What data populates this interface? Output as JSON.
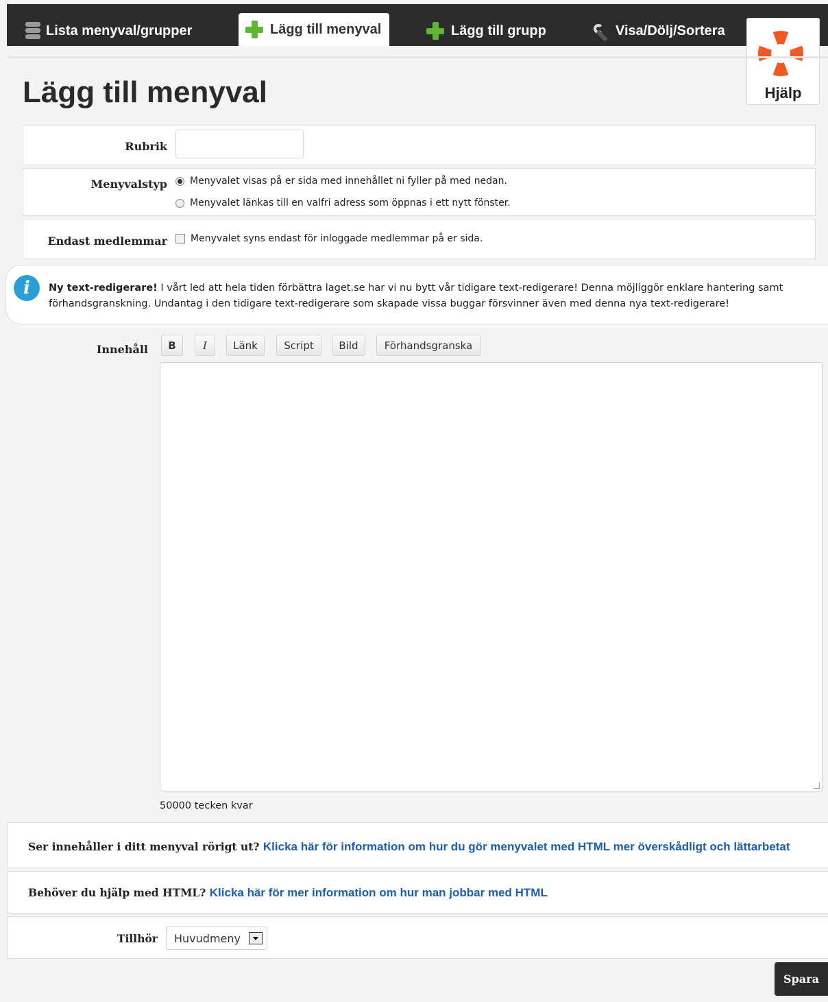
{
  "tabs": [
    {
      "label": "Lista menyval/grupper",
      "icon": "list-stack-icon"
    },
    {
      "label": "Lägg till menyval",
      "icon": "plus-icon"
    },
    {
      "label": "Lägg till grupp",
      "icon": "plus-icon"
    },
    {
      "label": "Visa/Dölj/Sortera",
      "icon": "wrench-icon"
    }
  ],
  "help": {
    "label": "Hjälp",
    "icon": "lifebuoy-icon"
  },
  "page": {
    "title": "Lägg till menyval"
  },
  "form": {
    "rubrik_label": "Rubrik",
    "rubrik_value": "",
    "type_label": "Menyvalstyp",
    "type_options": [
      {
        "label": "Menyvalet visas på er sida med innehållet ni fyller på med nedan.",
        "selected": true
      },
      {
        "label": "Menyvalet länkas till en valfri adress som öppnas i ett nytt fönster.",
        "selected": false
      }
    ],
    "members_label": "Endast medlemmar",
    "members_option": "Menyvalet syns endast för inloggade medlemmar på er sida.",
    "members_checked": false
  },
  "notice": {
    "title": "Ny text-redigerare!",
    "body": " I vårt led att hela tiden förbättra laget.se har vi nu bytt vår tidigare text-redigerare! Denna möjliggör enklare hantering samt förhandsgranskning. Undantag i den tidigare text-redigerare som skapade vissa buggar försvinner även med denna nya text-redigerare!"
  },
  "editor": {
    "label": "Innehåll",
    "toolbar": [
      "B",
      "I",
      "Länk",
      "Script",
      "Bild",
      "Förhandsgranska"
    ],
    "content": "",
    "chars_left": "50000 tecken kvar"
  },
  "help_rows": [
    {
      "text": "Ser innehåller i ditt menyval rörigt ut? ",
      "link": "Klicka här för information om hur du gör menyvalet med HTML mer överskådligt och lättarbetat"
    },
    {
      "text": "Behöver du hjälp med HTML? ",
      "link": "Klicka här för mer information om hur man jobbar med HTML"
    }
  ],
  "belongs": {
    "label": "Tillhör",
    "value": "Huvudmeny"
  },
  "save_label": "Spara"
}
